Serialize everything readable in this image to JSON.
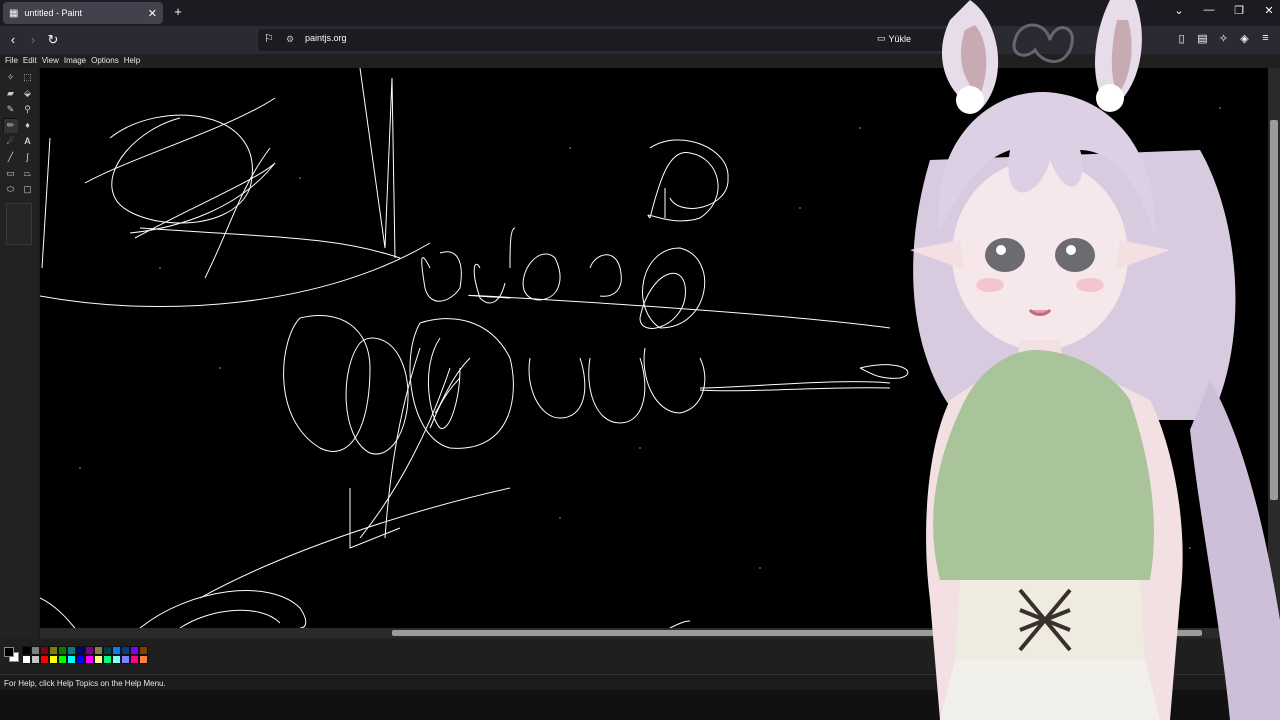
{
  "browser": {
    "tab": {
      "title": "untitled - Paint"
    },
    "url": "paintjs.org",
    "yukle_label": "Yükle",
    "window_controls": [
      "⌄",
      "—",
      "❐",
      "✕"
    ]
  },
  "app": {
    "menu": [
      "File",
      "Edit",
      "View",
      "Image",
      "Options",
      "Help"
    ],
    "status_text": "For Help, click Help Topics on the Help Menu."
  },
  "palette": {
    "row1": [
      "#000000",
      "#7f7f7f",
      "#880015",
      "#808000",
      "#008000",
      "#008080",
      "#000080",
      "#800080",
      "#808040",
      "#004040",
      "#0080ff",
      "#004080",
      "#8000ff",
      "#804000"
    ],
    "row2": [
      "#ffffff",
      "#c3c3c3",
      "#ff0000",
      "#ffff00",
      "#00ff00",
      "#00ffff",
      "#0000ff",
      "#ff00ff",
      "#ffff80",
      "#00ff80",
      "#80ffff",
      "#8080ff",
      "#ff0080",
      "#ff8040"
    ],
    "primary": "#000000",
    "secondary": "#ffffff"
  },
  "colors": {
    "canvas": "#000000",
    "stroke": "#ffffff",
    "chrome": "#2b2a33"
  }
}
